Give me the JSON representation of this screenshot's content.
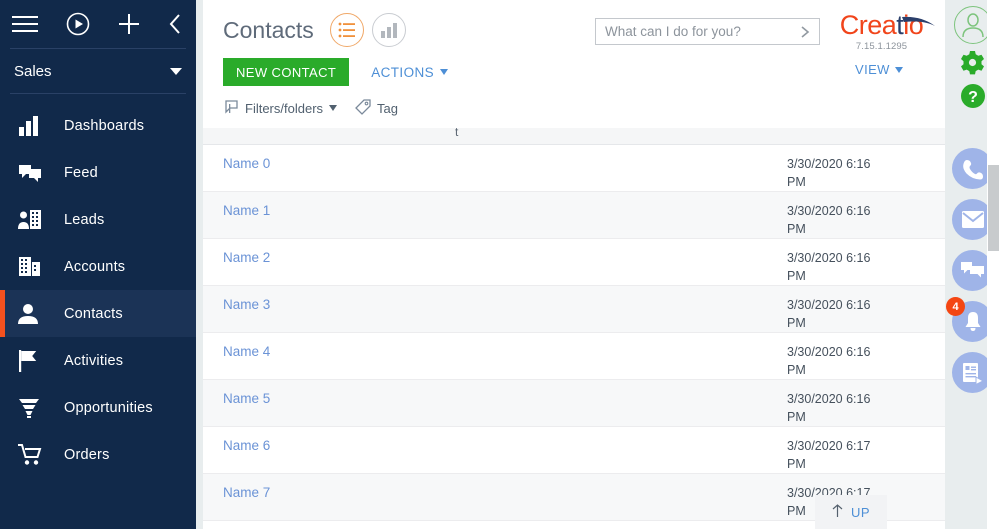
{
  "sidebar": {
    "top_icons": [
      {
        "name": "menu-icon",
        "label": "Menu"
      },
      {
        "name": "run-process-icon",
        "label": "Run process"
      },
      {
        "name": "add-icon",
        "label": "Add"
      },
      {
        "name": "collapse-icon",
        "label": "Collapse"
      }
    ],
    "workspace": "Sales",
    "items": [
      {
        "label": "Dashboards",
        "icon": "dashboards-icon",
        "active": false
      },
      {
        "label": "Feed",
        "icon": "feed-icon",
        "active": false
      },
      {
        "label": "Leads",
        "icon": "leads-icon",
        "active": false
      },
      {
        "label": "Accounts",
        "icon": "accounts-icon",
        "active": false
      },
      {
        "label": "Contacts",
        "icon": "contacts-icon",
        "active": true
      },
      {
        "label": "Activities",
        "icon": "activities-flag-icon",
        "active": false
      },
      {
        "label": "Opportunities",
        "icon": "opportunities-funnel-icon",
        "active": false
      },
      {
        "label": "Orders",
        "icon": "orders-cart-icon",
        "active": false
      }
    ]
  },
  "header": {
    "title": "Contacts",
    "view_list_label": "List view",
    "view_chart_label": "Chart view",
    "new_button": "NEW CONTACT",
    "actions_button": "ACTIONS",
    "filters_button": "Filters/folders",
    "tag_button": "Tag",
    "view_menu": "VIEW"
  },
  "search": {
    "placeholder": "What can I do for you?",
    "value": ""
  },
  "brand": {
    "name_part1": "Crea",
    "name_part2": "t",
    "name_part3": "io",
    "version": "7.15.1.1295"
  },
  "grid": {
    "partial_column_header": "t",
    "rows": [
      {
        "name": "Name 0",
        "date": "3/30/2020 6:16 PM"
      },
      {
        "name": "Name 1",
        "date": "3/30/2020 6:16 PM"
      },
      {
        "name": "Name 2",
        "date": "3/30/2020 6:16 PM"
      },
      {
        "name": "Name 3",
        "date": "3/30/2020 6:16 PM"
      },
      {
        "name": "Name 4",
        "date": "3/30/2020 6:16 PM"
      },
      {
        "name": "Name 5",
        "date": "3/30/2020 6:16 PM"
      },
      {
        "name": "Name 6",
        "date": "3/30/2020 6:17 PM"
      },
      {
        "name": "Name 7",
        "date": "3/30/2020 6:17 PM"
      }
    ],
    "up_button": "UP"
  },
  "rail": {
    "avatar_label": "User profile",
    "gear_label": "Settings",
    "help_label": "Help",
    "comm_items": [
      {
        "name": "phone-icon",
        "badge": ""
      },
      {
        "name": "email-icon",
        "badge": ""
      },
      {
        "name": "chat-icon",
        "badge": ""
      },
      {
        "name": "notifications-bell-icon",
        "badge": "4"
      },
      {
        "name": "process-log-icon",
        "badge": ""
      }
    ]
  },
  "colors": {
    "sidebar_bg": "#11294a",
    "active_accent": "#f4511e",
    "primary_green": "#2aab2a",
    "link_blue": "#4d8fd6",
    "brand_orange": "#f1451b",
    "brand_navy": "#2b3f6b",
    "badge_red": "#f44613"
  }
}
